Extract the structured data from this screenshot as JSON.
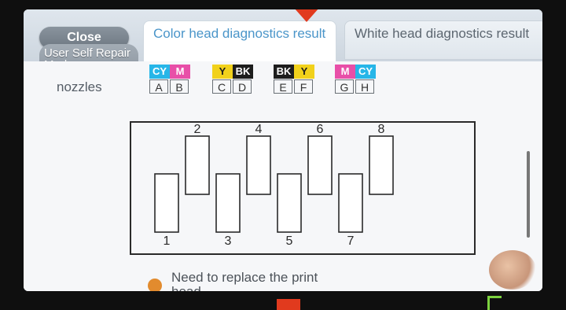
{
  "header": {
    "close_label": "Close",
    "mode_label": "User Self Repair Mode"
  },
  "tabs": [
    {
      "label": "Color head diagnostics result",
      "active": true
    },
    {
      "label": "White head diagnostics result",
      "active": false
    }
  ],
  "nozzles": {
    "label": "nozzles",
    "slots": [
      {
        "colors": [
          "CY",
          "M"
        ],
        "letters": [
          "A",
          "B"
        ]
      },
      {
        "colors": [
          "Y",
          "BK"
        ],
        "letters": [
          "C",
          "D"
        ]
      },
      {
        "colors": [
          "BK",
          "Y"
        ],
        "letters": [
          "E",
          "F"
        ]
      },
      {
        "colors": [
          "M",
          "CY"
        ],
        "letters": [
          "G",
          "H"
        ]
      }
    ],
    "color_map": {
      "CY": "#27b6e8",
      "M": "#e84fa8",
      "Y": "#f1d11b",
      "BK": "#1d1d1d"
    }
  },
  "diagram": {
    "labels": [
      "1",
      "2",
      "3",
      "4",
      "5",
      "6",
      "7",
      "8"
    ],
    "levels": [
      "low",
      "high",
      "low",
      "high",
      "low",
      "high",
      "low",
      "high"
    ]
  },
  "status": {
    "text": "Need to replace the print head",
    "dot_color": "#e28b2e"
  }
}
